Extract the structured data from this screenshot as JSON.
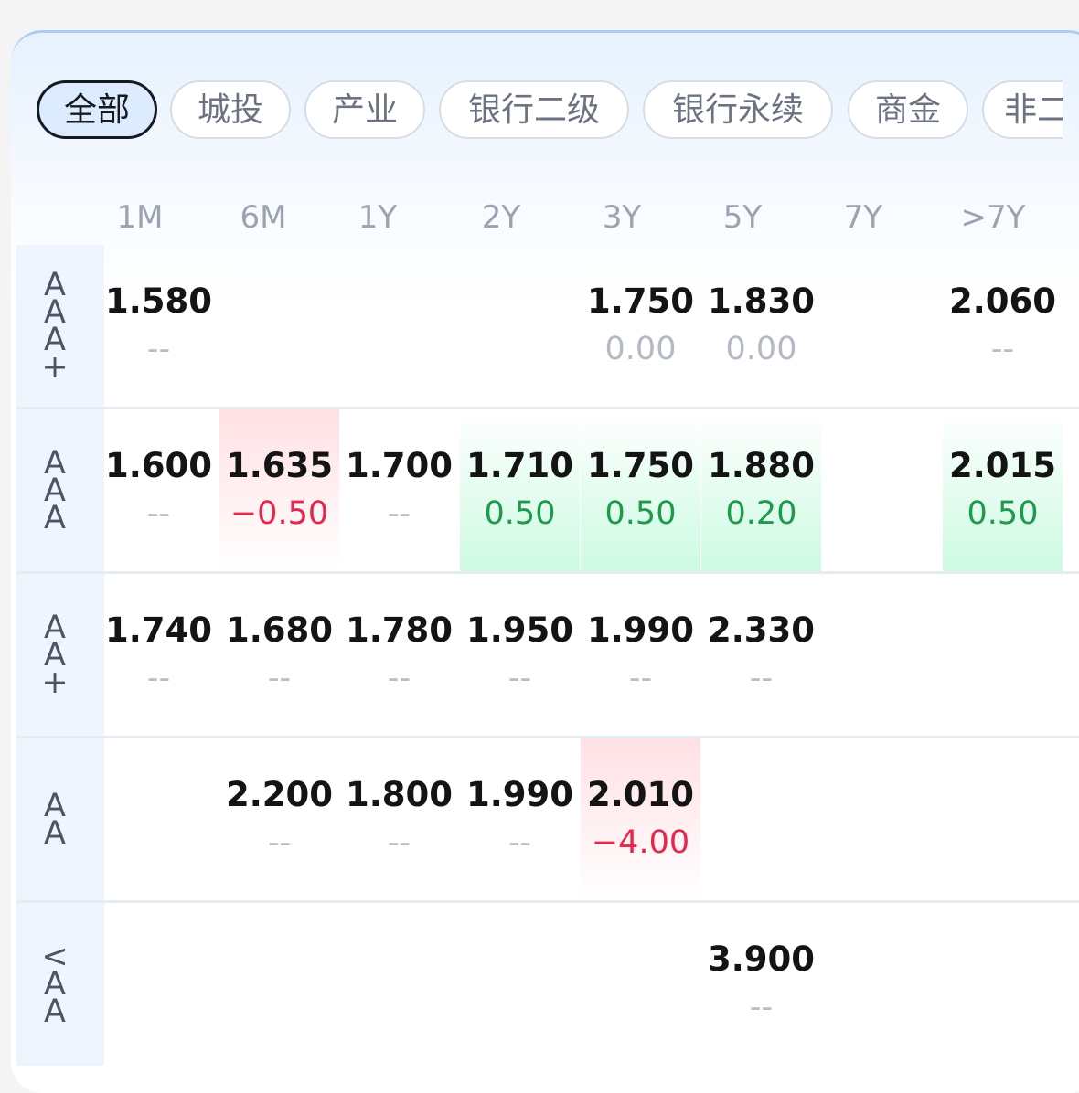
{
  "tabs": [
    "全部",
    "城投",
    "产业",
    "银行二级",
    "银行永续",
    "商金",
    "非二"
  ],
  "active_tab": "全部",
  "tenors": [
    "1M",
    "6M",
    "1Y",
    "2Y",
    "3Y",
    "5Y",
    "7Y",
    ">7Y"
  ],
  "colors": {
    "up": "#e8264b",
    "down": "#1f9a4b",
    "active_tab_bg": "#dcebfd"
  },
  "rows": [
    {
      "label": [
        "A",
        "A",
        "A",
        "+"
      ],
      "cells": [
        {
          "v": "1.580",
          "c": "--",
          "t": "none"
        },
        null,
        null,
        null,
        {
          "v": "1.750",
          "c": "0.00",
          "t": "flat"
        },
        {
          "v": "1.830",
          "c": "0.00",
          "t": "flat"
        },
        null,
        {
          "v": "2.060",
          "c": "--",
          "t": "none"
        }
      ]
    },
    {
      "label": [
        "A",
        "A",
        "A"
      ],
      "cells": [
        {
          "v": "1.600",
          "c": "--",
          "t": "none"
        },
        {
          "v": "1.635",
          "c": "−0.50",
          "t": "up"
        },
        {
          "v": "1.700",
          "c": "--",
          "t": "none"
        },
        {
          "v": "1.710",
          "c": "0.50",
          "t": "down"
        },
        {
          "v": "1.750",
          "c": "0.50",
          "t": "down"
        },
        {
          "v": "1.880",
          "c": "0.20",
          "t": "down"
        },
        null,
        {
          "v": "2.015",
          "c": "0.50",
          "t": "down"
        }
      ]
    },
    {
      "label": [
        "A",
        "A",
        "+"
      ],
      "cells": [
        {
          "v": "1.740",
          "c": "--",
          "t": "none"
        },
        {
          "v": "1.680",
          "c": "--",
          "t": "none"
        },
        {
          "v": "1.780",
          "c": "--",
          "t": "none"
        },
        {
          "v": "1.950",
          "c": "--",
          "t": "none"
        },
        {
          "v": "1.990",
          "c": "--",
          "t": "none"
        },
        {
          "v": "2.330",
          "c": "--",
          "t": "none"
        },
        null,
        null
      ]
    },
    {
      "label": [
        "A",
        "A"
      ],
      "cells": [
        null,
        {
          "v": "2.200",
          "c": "--",
          "t": "none"
        },
        {
          "v": "1.800",
          "c": "--",
          "t": "none"
        },
        {
          "v": "1.990",
          "c": "--",
          "t": "none"
        },
        {
          "v": "2.010",
          "c": "−4.00",
          "t": "up"
        },
        null,
        null,
        null
      ]
    },
    {
      "label": [
        "<",
        "A",
        "A"
      ],
      "cells": [
        null,
        null,
        null,
        null,
        null,
        {
          "v": "3.900",
          "c": "--",
          "t": "none"
        },
        null,
        null
      ]
    }
  ]
}
